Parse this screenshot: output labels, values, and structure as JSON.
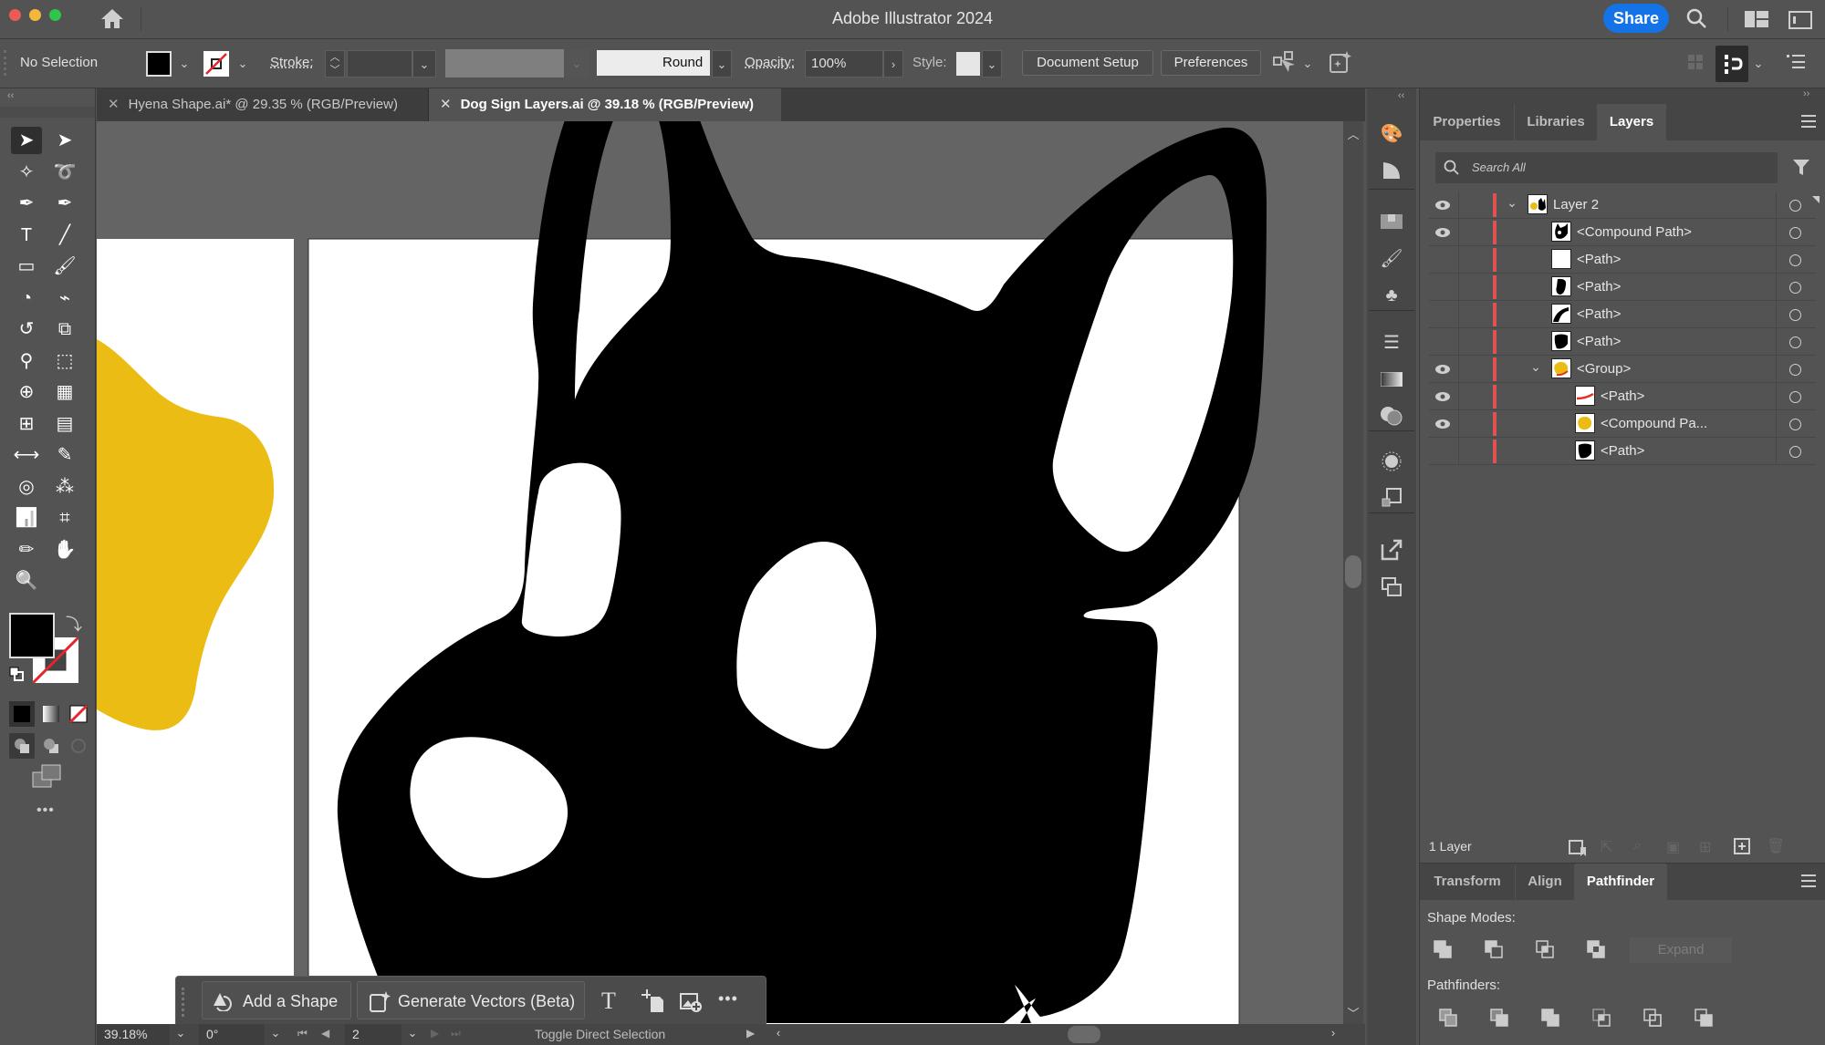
{
  "app": {
    "title": "Adobe Illustrator 2024",
    "share_label": "Share",
    "traffic_colors": [
      "#ee5b55",
      "#f5b73b",
      "#2ec54a"
    ]
  },
  "control_bar": {
    "selection_label": "No Selection",
    "fill_color": "#000000",
    "stroke_label": "Stroke:",
    "stroke_weight_value": "",
    "brush_label": "Round",
    "opacity_label": "Opacity:",
    "opacity_value": "100%",
    "style_label": "Style:",
    "document_setup_label": "Document Setup",
    "preferences_label": "Preferences"
  },
  "tabs": [
    {
      "label": "Hyena Shape.ai* @ 29.35 % (RGB/Preview)",
      "active": false
    },
    {
      "label": "Dog Sign Layers.ai @ 39.18 % (RGB/Preview)",
      "active": true
    }
  ],
  "toolbar": {
    "tools": [
      [
        "selection-tool",
        "direct-selection-tool"
      ],
      [
        "magic-wand-tool",
        "lasso-tool"
      ],
      [
        "pen-tool",
        "curvature-tool"
      ],
      [
        "type-tool",
        "line-segment-tool"
      ],
      [
        "rectangle-tool",
        "paintbrush-tool"
      ],
      [
        "shaper-tool",
        "eraser-tool"
      ],
      [
        "rotate-tool",
        "scale-tool"
      ],
      [
        "puppet-warp-tool",
        "free-transform-tool"
      ],
      [
        "shape-builder-tool",
        "perspective-grid-tool"
      ],
      [
        "mesh-tool",
        "gradient-tool"
      ],
      [
        "width-tool",
        "eyedropper-tool"
      ],
      [
        "blend-tool",
        "symbol-sprayer-tool"
      ],
      [
        "column-graph-tool",
        "artboard-tool"
      ],
      [
        "pencil-tool",
        "hand-tool"
      ],
      [
        "zoom-tool",
        ""
      ]
    ],
    "fill_color": "#000000",
    "stroke": "none",
    "more_label": "•••"
  },
  "canvas": {
    "artboard_color": "#ffffff",
    "dog_color": "#000000",
    "yellow_color": "#ebbd14"
  },
  "contextual_taskbar": {
    "add_shape_label": "Add a Shape",
    "generate_vectors_label": "Generate Vectors (Beta)",
    "more_label": "•••"
  },
  "status_bar": {
    "zoom_value": "39.18%",
    "rotation_value": "0°",
    "artboard_number": "2",
    "status_text": "Toggle Direct Selection"
  },
  "right_panel": {
    "tabs": [
      "Properties",
      "Libraries",
      "Layers"
    ],
    "active_tab": "Layers",
    "search_placeholder": "Search All",
    "layers": [
      {
        "name": "Layer 2",
        "indent": 0,
        "visible": true,
        "expanded": true,
        "thumb": "layer"
      },
      {
        "name": "<Compound Path>",
        "indent": 1,
        "visible": true,
        "thumb": "dog-head"
      },
      {
        "name": "<Path>",
        "indent": 1,
        "visible": false,
        "thumb": "white"
      },
      {
        "name": "<Path>",
        "indent": 1,
        "visible": false,
        "thumb": "black-blob"
      },
      {
        "name": "<Path>",
        "indent": 1,
        "visible": false,
        "thumb": "black-curve"
      },
      {
        "name": "<Path>",
        "indent": 1,
        "visible": false,
        "thumb": "black-shape"
      },
      {
        "name": "<Group>",
        "indent": 1,
        "visible": true,
        "expanded": true,
        "thumb": "yellow-group"
      },
      {
        "name": "<Path>",
        "indent": 2,
        "visible": true,
        "thumb": "red-line"
      },
      {
        "name": "<Compound Pa...",
        "indent": 2,
        "visible": true,
        "thumb": "yellow"
      },
      {
        "name": "<Path>",
        "indent": 2,
        "visible": false,
        "thumb": "black-shape"
      }
    ],
    "layer_count": "1 Layer",
    "bottom_tabs": [
      "Transform",
      "Align",
      "Pathfinder"
    ],
    "active_bottom_tab": "Pathfinder",
    "shape_modes_label": "Shape Modes:",
    "expand_label": "Expand",
    "pathfinders_label": "Pathfinders:",
    "layer_color": "#e05252"
  }
}
